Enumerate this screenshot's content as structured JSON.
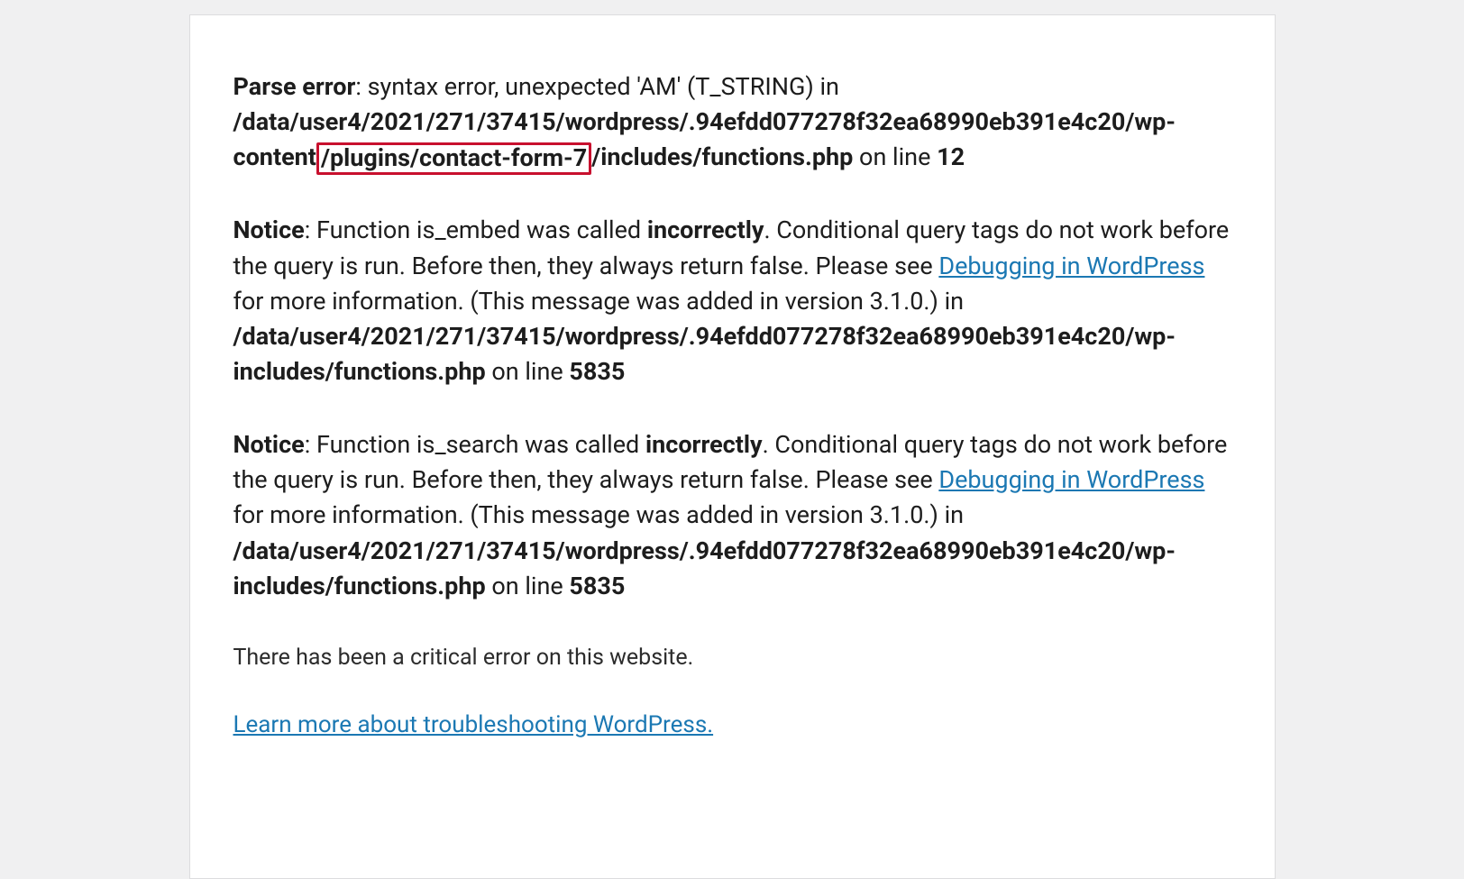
{
  "error": {
    "label": "Parse error",
    "message": ": syntax error, unexpected 'AM' (T_STRING) in ",
    "path_before": "/data/user4/2021/271/37415/wordpress/.94efdd077278f32ea68990eb391e4c20/wp-content",
    "path_highlight": "/plugins/contact-form-7",
    "path_after": "/includes/functions.php",
    "on_line_text": " on line ",
    "line_number": "12"
  },
  "notice1": {
    "label": "Notice",
    "pre_text": ": Function is_embed was called ",
    "incorrectly": "incorrectly",
    "post_text1": ". Conditional query tags do not work before the query is run. Before then, they always return false. Please see ",
    "link_text": "Debugging in WordPress",
    "post_text2": " for more information. (This message was added in version 3.1.0.) in ",
    "path": "/data/user4/2021/271/37415/wordpress/.94efdd077278f32ea68990eb391e4c20/wp-includes/functions.php",
    "on_line_text": " on line ",
    "line_number": "5835"
  },
  "notice2": {
    "label": "Notice",
    "pre_text": ": Function is_search was called ",
    "incorrectly": "incorrectly",
    "post_text1": ". Conditional query tags do not work before the query is run. Before then, they always return false. Please see ",
    "link_text": "Debugging in WordPress",
    "post_text2": " for more information. (This message was added in version 3.1.0.) in ",
    "path": "/data/user4/2021/271/37415/wordpress/.94efdd077278f32ea68990eb391e4c20/wp-includes/functions.php",
    "on_line_text": " on line ",
    "line_number": "5835"
  },
  "critical_message": "There has been a critical error on this website.",
  "learn_more": "Learn more about troubleshooting WordPress."
}
